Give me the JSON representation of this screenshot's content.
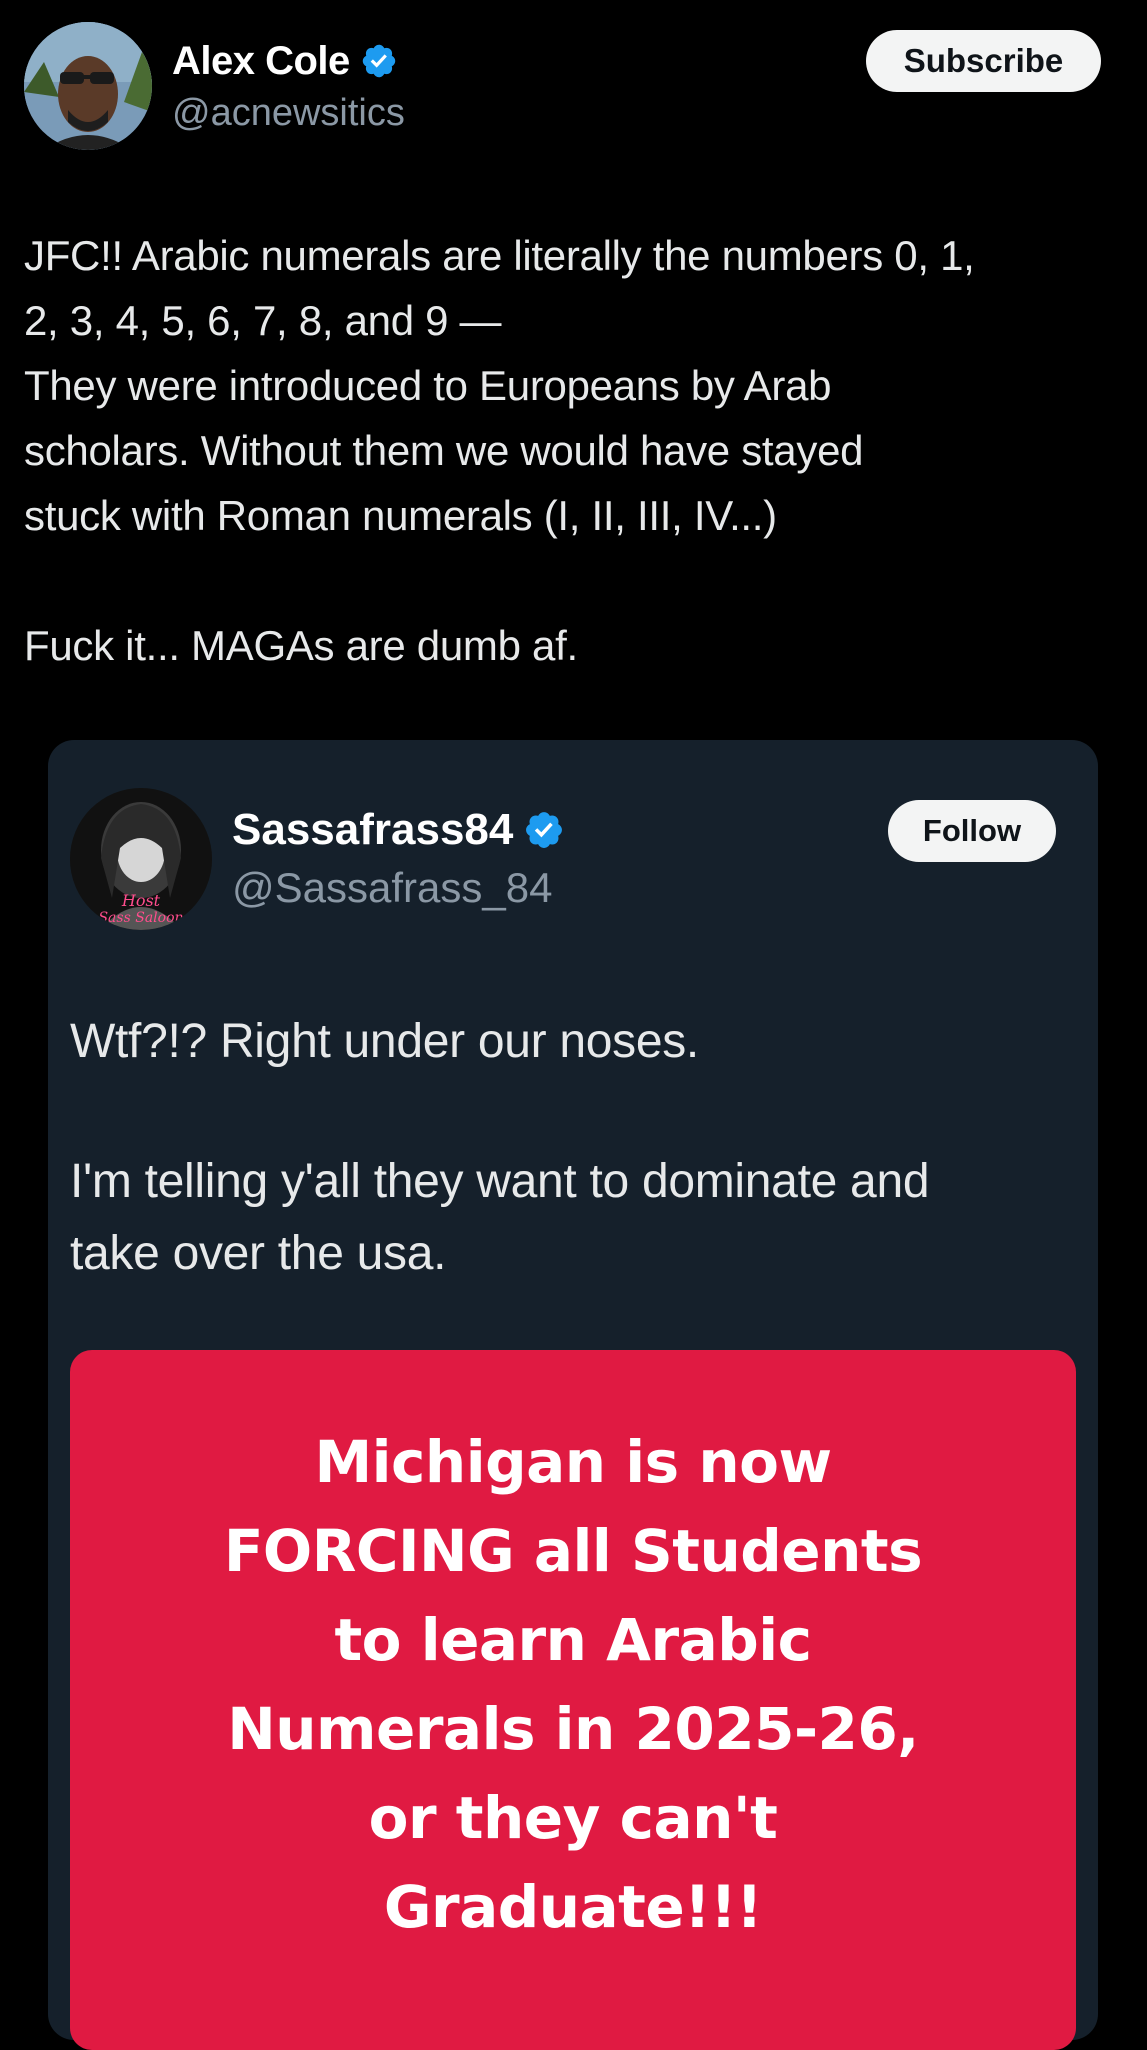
{
  "post": {
    "author": {
      "display_name": "Alex Cole",
      "handle": "@acnewsitics",
      "verified_icon": "verified-badge-icon"
    },
    "subscribe_label": "Subscribe",
    "text_lines": [
      "JFC!! Arabic numerals are literally the numbers 0, 1,",
      "2, 3, 4, 5, 6, 7, 8, and 9 —",
      "They were introduced to Europeans by Arab",
      "scholars. Without them we would have stayed",
      "stuck with Roman numerals (I, II, III, IV...)",
      "",
      "Fuck it... MAGAs are dumb af."
    ]
  },
  "quoted_post": {
    "author": {
      "display_name": "Sassafrass84",
      "handle": "@Sassafrass_84",
      "verified_icon": "verified-badge-icon",
      "avatar_logo_text": "Host of the Sass Saloon"
    },
    "follow_label": "Follow",
    "text_lines": [
      "Wtf?!? Right under our noses.",
      "",
      "I'm telling y'all they want to dominate and",
      "take over the usa."
    ],
    "image_card": {
      "background_color": "#e01a42",
      "text_lines": [
        "Michigan is now",
        "FORCING all Students",
        "to learn Arabic",
        "Numerals in 2025-26,",
        "or they can't",
        "Graduate!!!"
      ]
    }
  },
  "colors": {
    "background": "#000000",
    "card_background": "#15202b",
    "verified_blue": "#1d9bf0",
    "text_primary": "#e7e9ea",
    "text_secondary": "#8b98a5"
  }
}
